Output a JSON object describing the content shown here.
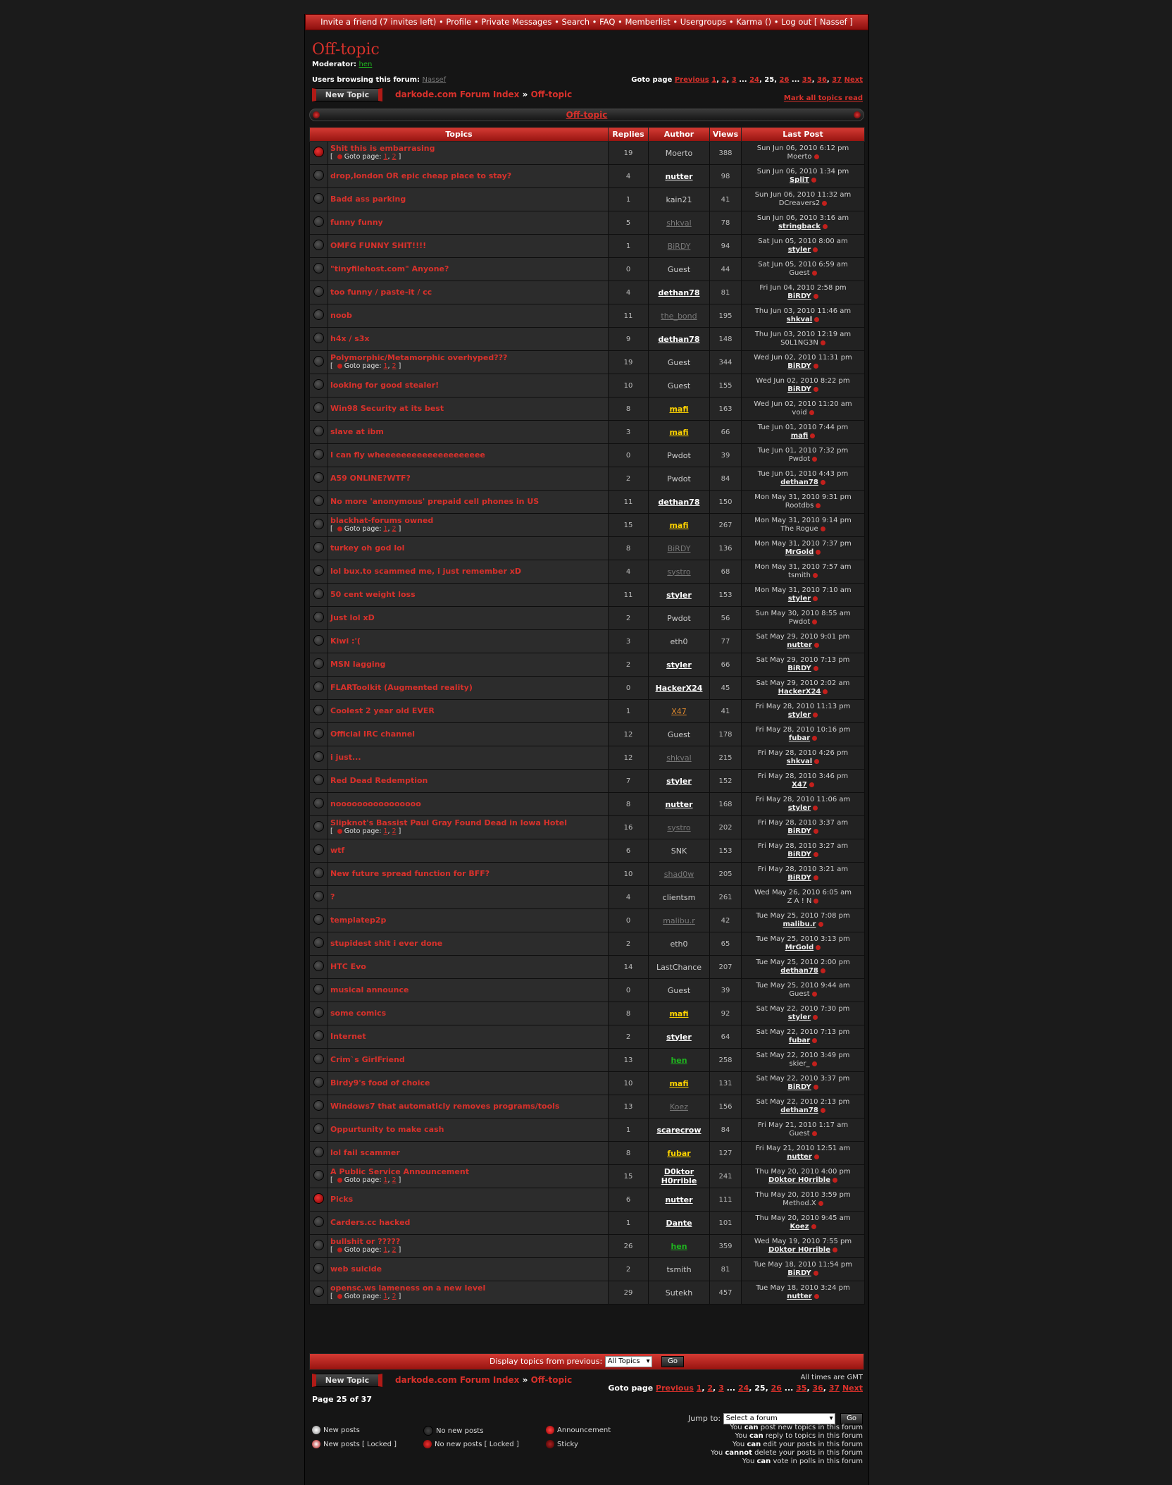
{
  "topbar": {
    "text": "Invite a friend (7 invites left) • Profile • Private Messages • Search • FAQ • Memberlist • Usergroups • Karma () • Log out [ Nassef ]"
  },
  "forum": {
    "title": "Off-topic",
    "moderator_label": "Moderator:",
    "moderator": "hen",
    "browsing_label": "Users browsing this forum:",
    "browsing_user": "Nassef"
  },
  "pagination": {
    "label": "Goto page",
    "prev": "Previous",
    "p1": "1",
    "p2": "2",
    "p3": "3",
    "dots": "...",
    "p24": "24",
    "current": "25",
    "p26": "26",
    "p35": "35",
    "p36": "36",
    "p37": "37",
    "next": "Next",
    "page_of": "Page 25 of 37"
  },
  "buttons": {
    "new_topic": "New Topic",
    "go": "Go"
  },
  "breadcrumb": {
    "index": "darkode.com Forum Index",
    "sep": "»",
    "forum": "Off-topic"
  },
  "mark_all": "Mark all topics read",
  "caption": "Off-topic",
  "columns": {
    "topics": "Topics",
    "replies": "Replies",
    "author": "Author",
    "views": "Views",
    "last_post": "Last Post"
  },
  "topics": [
    {
      "title": "Shit this is embarrasing",
      "pages": true,
      "replies": "19",
      "author": "Moerto",
      "ac": "plain",
      "views": "388",
      "date": "Sun Jun 06, 2010 6:12 pm",
      "lp": "Moerto",
      "lc": "plain",
      "locked": true
    },
    {
      "title": "drop,london OR epic cheap place to stay?",
      "replies": "4",
      "author": "nutter",
      "ac": "reg",
      "views": "98",
      "date": "Sun Jun 06, 2010 1:34 pm",
      "lp": "SpliT",
      "lc": "reg"
    },
    {
      "title": "Badd ass parking",
      "replies": "1",
      "author": "kain21",
      "ac": "plain",
      "views": "41",
      "date": "Sun Jun 06, 2010 11:32 am",
      "lp": "DCreavers2",
      "lc": "plain"
    },
    {
      "title": "funny funny",
      "replies": "5",
      "author": "shkval",
      "ac": "dim",
      "views": "78",
      "date": "Sun Jun 06, 2010 3:16 am",
      "lp": "stringback",
      "lc": "reg"
    },
    {
      "title": "OMFG FUNNY SHIT!!!!",
      "replies": "1",
      "author": "BiRDY",
      "ac": "dim",
      "views": "94",
      "date": "Sat Jun 05, 2010 8:00 am",
      "lp": "styler",
      "lc": "reg"
    },
    {
      "title": "\"tinyfilehost.com\" Anyone?",
      "replies": "0",
      "author": "Guest",
      "ac": "plain",
      "views": "44",
      "date": "Sat Jun 05, 2010 6:59 am",
      "lp": "Guest",
      "lc": "plain"
    },
    {
      "title": "too funny / paste-it / cc",
      "replies": "4",
      "author": "dethan78",
      "ac": "reg",
      "views": "81",
      "date": "Fri Jun 04, 2010 2:58 pm",
      "lp": "BiRDY",
      "lc": "reg"
    },
    {
      "title": "noob",
      "replies": "11",
      "author": "the_bond",
      "ac": "dim",
      "views": "195",
      "date": "Thu Jun 03, 2010 11:46 am",
      "lp": "shkval",
      "lc": "reg"
    },
    {
      "title": "h4x / s3x",
      "replies": "9",
      "author": "dethan78",
      "ac": "reg",
      "views": "148",
      "date": "Thu Jun 03, 2010 12:19 am",
      "lp": "S0L1NG3N",
      "lc": "plain"
    },
    {
      "title": "Polymorphic/Metamorphic overhyped???",
      "pages": true,
      "replies": "19",
      "author": "Guest",
      "ac": "plain",
      "views": "344",
      "date": "Wed Jun 02, 2010 11:31 pm",
      "lp": "BiRDY",
      "lc": "reg"
    },
    {
      "title": "looking for good stealer!",
      "replies": "10",
      "author": "Guest",
      "ac": "plain",
      "views": "155",
      "date": "Wed Jun 02, 2010 8:22 pm",
      "lp": "BiRDY",
      "lc": "reg"
    },
    {
      "title": "Win98 Security at its best",
      "replies": "8",
      "author": "mafi",
      "ac": "gold",
      "views": "163",
      "date": "Wed Jun 02, 2010 11:20 am",
      "lp": "void",
      "lc": "plain"
    },
    {
      "title": "slave at ibm",
      "replies": "3",
      "author": "mafi",
      "ac": "gold",
      "views": "66",
      "date": "Tue Jun 01, 2010 7:44 pm",
      "lp": "mafi",
      "lc": "reg"
    },
    {
      "title": "I can fly wheeeeeeeeeeeeeeeeeeee",
      "replies": "0",
      "author": "Pwdot",
      "ac": "plain",
      "views": "39",
      "date": "Tue Jun 01, 2010 7:32 pm",
      "lp": "Pwdot",
      "lc": "plain"
    },
    {
      "title": "A59 ONLINE?WTF?",
      "replies": "2",
      "author": "Pwdot",
      "ac": "plain",
      "views": "84",
      "date": "Tue Jun 01, 2010 4:43 pm",
      "lp": "dethan78",
      "lc": "reg"
    },
    {
      "title": "No more 'anonymous' prepaid cell phones in US",
      "replies": "11",
      "author": "dethan78",
      "ac": "reg",
      "views": "150",
      "date": "Mon May 31, 2010 9:31 pm",
      "lp": "Rootdbs",
      "lc": "plain"
    },
    {
      "title": "blackhat-forums owned",
      "pages": true,
      "replies": "15",
      "author": "mafi",
      "ac": "gold",
      "views": "267",
      "date": "Mon May 31, 2010 9:14 pm",
      "lp": "The Rogue",
      "lc": "plain"
    },
    {
      "title": "turkey oh god lol",
      "replies": "8",
      "author": "BiRDY",
      "ac": "dim",
      "views": "136",
      "date": "Mon May 31, 2010 7:37 pm",
      "lp": "MrGold",
      "lc": "reg"
    },
    {
      "title": "lol bux.to scammed me, i just remember xD",
      "replies": "4",
      "author": "systro",
      "ac": "dim",
      "views": "68",
      "date": "Mon May 31, 2010 7:57 am",
      "lp": "tsmith",
      "lc": "plain"
    },
    {
      "title": "50 cent weight loss",
      "replies": "11",
      "author": "styler",
      "ac": "reg",
      "views": "153",
      "date": "Mon May 31, 2010 7:10 am",
      "lp": "styler",
      "lc": "reg"
    },
    {
      "title": "Just lol xD",
      "replies": "2",
      "author": "Pwdot",
      "ac": "plain",
      "views": "56",
      "date": "Sun May 30, 2010 8:55 am",
      "lp": "Pwdot",
      "lc": "plain"
    },
    {
      "title": "Kiwi :'(",
      "replies": "3",
      "author": "eth0",
      "ac": "plain",
      "views": "77",
      "date": "Sat May 29, 2010 9:01 pm",
      "lp": "nutter",
      "lc": "reg"
    },
    {
      "title": "MSN lagging",
      "replies": "2",
      "author": "styler",
      "ac": "reg",
      "views": "66",
      "date": "Sat May 29, 2010 7:13 pm",
      "lp": "BiRDY",
      "lc": "reg"
    },
    {
      "title": "FLARToolkit (Augmented reality)",
      "replies": "0",
      "author": "HackerX24",
      "ac": "reg",
      "views": "45",
      "date": "Sat May 29, 2010 2:02 am",
      "lp": "HackerX24",
      "lc": "reg"
    },
    {
      "title": "Coolest 2 year old EVER",
      "replies": "1",
      "author": "X47",
      "ac": "orange",
      "views": "41",
      "date": "Fri May 28, 2010 11:13 pm",
      "lp": "styler",
      "lc": "reg"
    },
    {
      "title": "Official IRC channel",
      "replies": "12",
      "author": "Guest",
      "ac": "plain",
      "views": "178",
      "date": "Fri May 28, 2010 10:16 pm",
      "lp": "fubar",
      "lc": "reg"
    },
    {
      "title": "i just...",
      "replies": "12",
      "author": "shkval",
      "ac": "dim",
      "views": "215",
      "date": "Fri May 28, 2010 4:26 pm",
      "lp": "shkval",
      "lc": "reg"
    },
    {
      "title": "Red Dead Redemption",
      "replies": "7",
      "author": "styler",
      "ac": "reg",
      "views": "152",
      "date": "Fri May 28, 2010 3:46 pm",
      "lp": "X47",
      "lc": "reg"
    },
    {
      "title": "noooooooooooooooo",
      "replies": "8",
      "author": "nutter",
      "ac": "reg",
      "views": "168",
      "date": "Fri May 28, 2010 11:06 am",
      "lp": "styler",
      "lc": "reg"
    },
    {
      "title": "Slipknot's Bassist Paul Gray Found Dead in Iowa Hotel",
      "pages": true,
      "replies": "16",
      "author": "systro",
      "ac": "dim",
      "views": "202",
      "date": "Fri May 28, 2010 3:37 am",
      "lp": "BiRDY",
      "lc": "reg"
    },
    {
      "title": "wtf",
      "replies": "6",
      "author": "SNK",
      "ac": "plain",
      "views": "153",
      "date": "Fri May 28, 2010 3:27 am",
      "lp": "BiRDY",
      "lc": "reg"
    },
    {
      "title": "New future spread function for BFF?",
      "replies": "10",
      "author": "shad0w",
      "ac": "dim",
      "views": "205",
      "date": "Fri May 28, 2010 3:21 am",
      "lp": "BiRDY",
      "lc": "reg"
    },
    {
      "title": "?",
      "replies": "4",
      "author": "clientsm",
      "ac": "plain",
      "views": "261",
      "date": "Wed May 26, 2010 6:05 am",
      "lp": "Z A ! N",
      "lc": "plain"
    },
    {
      "title": "templatep2p",
      "replies": "0",
      "author": "malibu.r",
      "ac": "dim",
      "views": "42",
      "date": "Tue May 25, 2010 7:08 pm",
      "lp": "malibu.r",
      "lc": "reg"
    },
    {
      "title": "stupidest shit i ever done",
      "replies": "2",
      "author": "eth0",
      "ac": "plain",
      "views": "65",
      "date": "Tue May 25, 2010 3:13 pm",
      "lp": "MrGold",
      "lc": "reg"
    },
    {
      "title": "HTC Evo",
      "replies": "14",
      "author": "LastChance",
      "ac": "plain",
      "views": "207",
      "date": "Tue May 25, 2010 2:00 pm",
      "lp": "dethan78",
      "lc": "reg"
    },
    {
      "title": "musical announce",
      "replies": "0",
      "author": "Guest",
      "ac": "plain",
      "views": "39",
      "date": "Tue May 25, 2010 9:44 am",
      "lp": "Guest",
      "lc": "plain"
    },
    {
      "title": "some comics",
      "replies": "8",
      "author": "mafi",
      "ac": "gold",
      "views": "92",
      "date": "Sat May 22, 2010 7:30 pm",
      "lp": "styler",
      "lc": "reg"
    },
    {
      "title": "Internet",
      "replies": "2",
      "author": "styler",
      "ac": "reg",
      "views": "64",
      "date": "Sat May 22, 2010 7:13 pm",
      "lp": "fubar",
      "lc": "reg"
    },
    {
      "title": "Crim`s GirlFriend",
      "replies": "13",
      "author": "hen",
      "ac": "green",
      "views": "258",
      "date": "Sat May 22, 2010 3:49 pm",
      "lp": "skier_",
      "lc": "plain"
    },
    {
      "title": "Birdy9's food of choice",
      "replies": "10",
      "author": "mafi",
      "ac": "gold",
      "views": "131",
      "date": "Sat May 22, 2010 3:37 pm",
      "lp": "BiRDY",
      "lc": "reg"
    },
    {
      "title": "Windows7 that automaticly removes programs/tools",
      "replies": "13",
      "author": "Koez",
      "ac": "dim",
      "views": "156",
      "date": "Sat May 22, 2010 2:13 pm",
      "lp": "dethan78",
      "lc": "reg"
    },
    {
      "title": "Oppurtunity to make cash",
      "replies": "1",
      "author": "scarecrow",
      "ac": "reg",
      "views": "84",
      "date": "Fri May 21, 2010 1:17 am",
      "lp": "Guest",
      "lc": "plain"
    },
    {
      "title": "lol fail scammer",
      "replies": "8",
      "author": "fubar",
      "ac": "gold",
      "views": "127",
      "date": "Fri May 21, 2010 12:51 am",
      "lp": "nutter",
      "lc": "reg"
    },
    {
      "title": "A Public Service Announcement",
      "pages": true,
      "replies": "15",
      "author": "D0ktor H0rrible",
      "ac": "reg",
      "views": "241",
      "date": "Thu May 20, 2010 4:00 pm",
      "lp": "D0ktor H0rrible",
      "lc": "reg"
    },
    {
      "title": "Picks",
      "replies": "6",
      "author": "nutter",
      "ac": "reg",
      "views": "111",
      "date": "Thu May 20, 2010 3:59 pm",
      "lp": "Method.X",
      "lc": "plain",
      "locked": true
    },
    {
      "title": "Carders.cc hacked",
      "replies": "1",
      "author": "Dante",
      "ac": "reg",
      "views": "101",
      "date": "Thu May 20, 2010 9:45 am",
      "lp": "Koez",
      "lc": "reg"
    },
    {
      "title": "bullshit or ?????",
      "pages": true,
      "replies": "26",
      "author": "hen",
      "ac": "green",
      "views": "359",
      "date": "Wed May 19, 2010 7:55 pm",
      "lp": "D0ktor H0rrible",
      "lc": "reg"
    },
    {
      "title": "web suicide",
      "replies": "2",
      "author": "tsmith",
      "ac": "plain",
      "views": "81",
      "date": "Tue May 18, 2010 11:54 pm",
      "lp": "BiRDY",
      "lc": "reg"
    },
    {
      "title": "opensc.ws lameness on a new level",
      "pages": true,
      "replies": "29",
      "author": "Sutekh",
      "ac": "plain",
      "views": "457",
      "date": "Tue May 18, 2010 3:24 pm",
      "lp": "nutter",
      "lc": "reg"
    }
  ],
  "topic_pages": {
    "open": "[",
    "label": "Goto page:",
    "p1": "1",
    "sep": ",",
    "p2": "2",
    "close": "]"
  },
  "display_bar": {
    "label": "Display topics from previous:",
    "select": "All Topics"
  },
  "all_times": "All times are GMT",
  "jump": {
    "label": "Jump to:",
    "select": "Select a forum"
  },
  "legend": {
    "new_posts": "New posts",
    "new_posts_locked": "New posts [ Locked ]",
    "no_new_posts": "No new posts",
    "no_new_posts_locked": "No new posts [ Locked ]",
    "announcement": "Announcement",
    "sticky": "Sticky"
  },
  "permissions": [
    {
      "pre": "You ",
      "b": "can",
      "post": " post new topics in this forum"
    },
    {
      "pre": "You ",
      "b": "can",
      "post": " reply to topics in this forum"
    },
    {
      "pre": "You ",
      "b": "can",
      "post": " edit your posts in this forum"
    },
    {
      "pre": "You ",
      "b": "cannot",
      "post": " delete your posts in this forum"
    },
    {
      "pre": "You ",
      "b": "can",
      "post": " vote in polls in this forum"
    }
  ]
}
